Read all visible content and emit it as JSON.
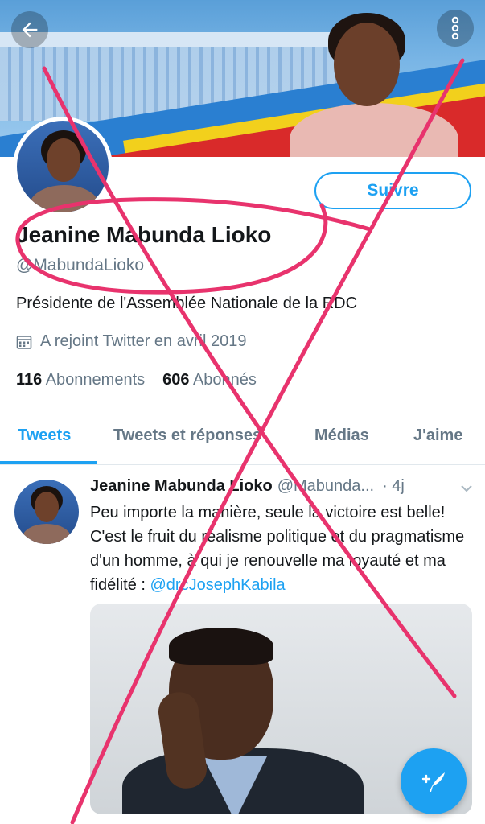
{
  "header": {
    "back_icon": "arrow-left-icon",
    "more_icon": "more-vertical-icon"
  },
  "profile": {
    "name": "Jeanine Mabunda Lioko",
    "handle": "@MabundaLioko",
    "bio": "Présidente de l'Assemblée Nationale de la RDC",
    "joined": "A rejoint Twitter en avril 2019",
    "following_count": "116",
    "following_label": "Abonnements",
    "followers_count": "606",
    "followers_label": "Abonnés",
    "follow_label": "Suivre"
  },
  "tabs": [
    {
      "label": "Tweets",
      "active": true
    },
    {
      "label": "Tweets et réponses",
      "active": false
    },
    {
      "label": "Médias",
      "active": false
    },
    {
      "label": "J'aime",
      "active": false
    }
  ],
  "tweet": {
    "author": "Jeanine Mabunda Lioko",
    "handle": "@Mabunda...",
    "time": "· 4j",
    "text_before": "Peu importe la manière, seule la victoire est belle! C'est le fruit du réalisme politique et du pragmatisme d'un homme, à qui je renouvelle ma loyauté et ma fidélité : ",
    "mention": "@drcJosephKabila"
  },
  "colors": {
    "accent": "#1da1f2",
    "annotation": "#e8336d"
  }
}
